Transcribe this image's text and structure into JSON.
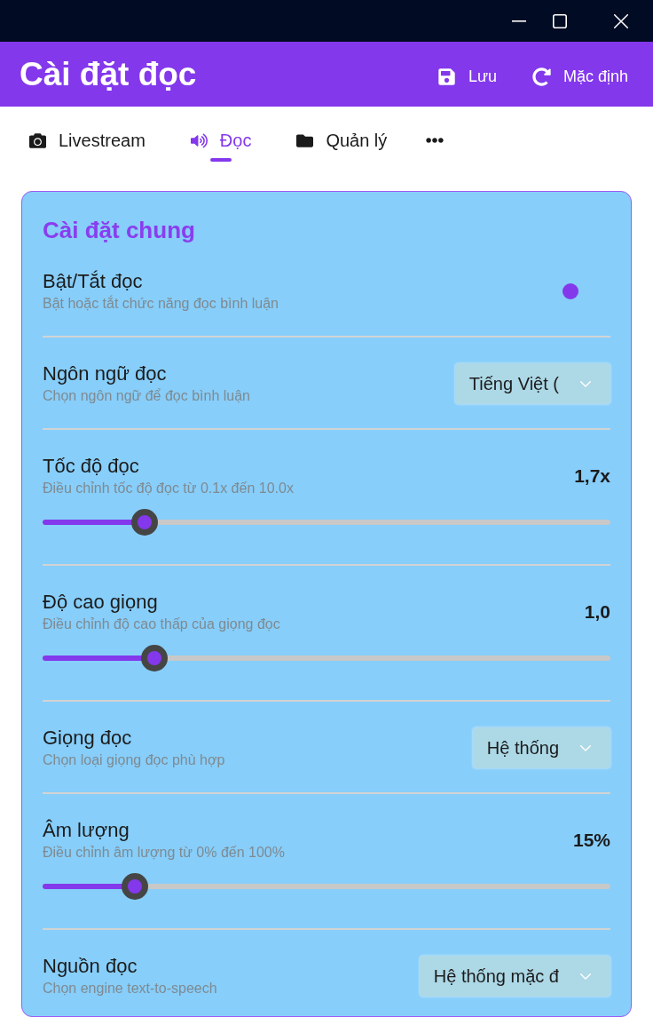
{
  "header": {
    "title": "Cài đặt đọc",
    "buttons": [
      {
        "label": "Lưu"
      },
      {
        "label": "Mặc định"
      }
    ]
  },
  "tabs": [
    {
      "label": "Livestream",
      "selected": false
    },
    {
      "label": "Đọc",
      "selected": true
    },
    {
      "label": "Quản lý",
      "selected": false
    }
  ],
  "settings": {
    "title": "Cài đặt chung",
    "rows": [
      {
        "kind": "toggle",
        "label": "Bật/Tắt đọc",
        "description": "Bật hoặc tắt chức năng đọc bình luận",
        "on": true
      },
      {
        "kind": "select",
        "label": "Ngôn ngữ đọc",
        "description": "Chọn ngôn ngữ để đọc bình luận",
        "value": "Tiếng Việt ("
      },
      {
        "kind": "slider",
        "label": "Tốc độ đọc",
        "description": "Điều chỉnh tốc độ đọc từ 0.1x đến 10.0x",
        "reading": "1,7x",
        "level": 0.18
      },
      {
        "kind": "slider",
        "label": "Độ cao giọng",
        "description": "Điều chỉnh độ cao thấp của giọng đọc",
        "reading": "1,0",
        "level": 0.197
      },
      {
        "kind": "select",
        "label": "Giọng đọc",
        "description": "Chọn loại giọng đọc phù hợp",
        "value": "Hệ thống"
      },
      {
        "kind": "slider",
        "label": "Âm lượng",
        "description": "Điều chỉnh âm lượng từ 0% đến 100%",
        "reading": "15%",
        "level": 0.162
      },
      {
        "kind": "select",
        "label": "Nguồn đọc",
        "description": "Chọn engine text-to-speech",
        "value": "Hệ thống mặc đ"
      }
    ]
  }
}
